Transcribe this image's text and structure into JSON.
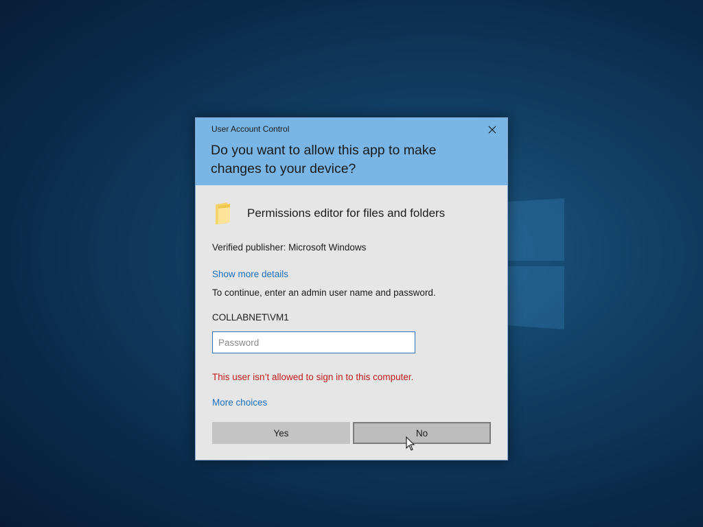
{
  "dialog": {
    "window_title": "User Account Control",
    "question": "Do you want to allow this app to make changes to your device?",
    "app_name": "Permissions editor for files and folders",
    "app_icon": "folder-icon",
    "publisher": "Verified publisher: Microsoft Windows",
    "show_details": "Show more details",
    "instruction": "To continue, enter an admin user name and password.",
    "username": "COLLABNET\\VM1",
    "password": {
      "value": "",
      "placeholder": "Password"
    },
    "error": "This user isn’t allowed to sign in to this computer.",
    "more_choices": "More choices",
    "yes_label": "Yes",
    "no_label": "No"
  },
  "colors": {
    "header": "#79b6e6",
    "body": "#e6e6e6",
    "link": "#1a6fbf",
    "error": "#c41a1a"
  }
}
